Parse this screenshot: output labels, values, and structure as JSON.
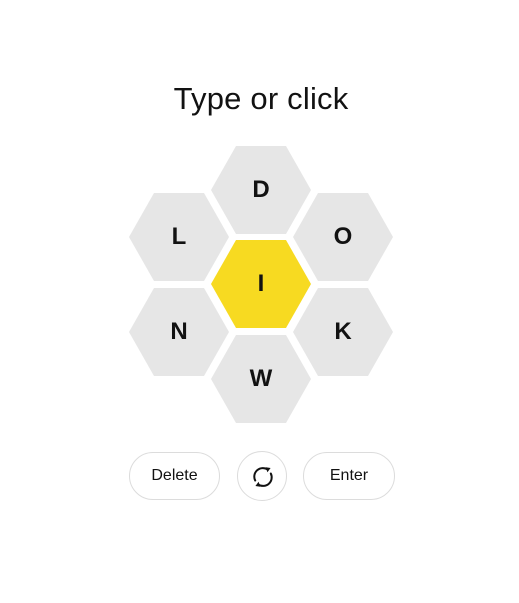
{
  "prompt": "Type or click",
  "hive": {
    "center": {
      "letter": "I",
      "color": "#f7da21"
    },
    "outer_color": "#e6e6e6",
    "outer": [
      "D",
      "O",
      "K",
      "W",
      "N",
      "L"
    ]
  },
  "controls": {
    "delete_label": "Delete",
    "shuffle_icon": "shuffle-icon",
    "enter_label": "Enter"
  }
}
